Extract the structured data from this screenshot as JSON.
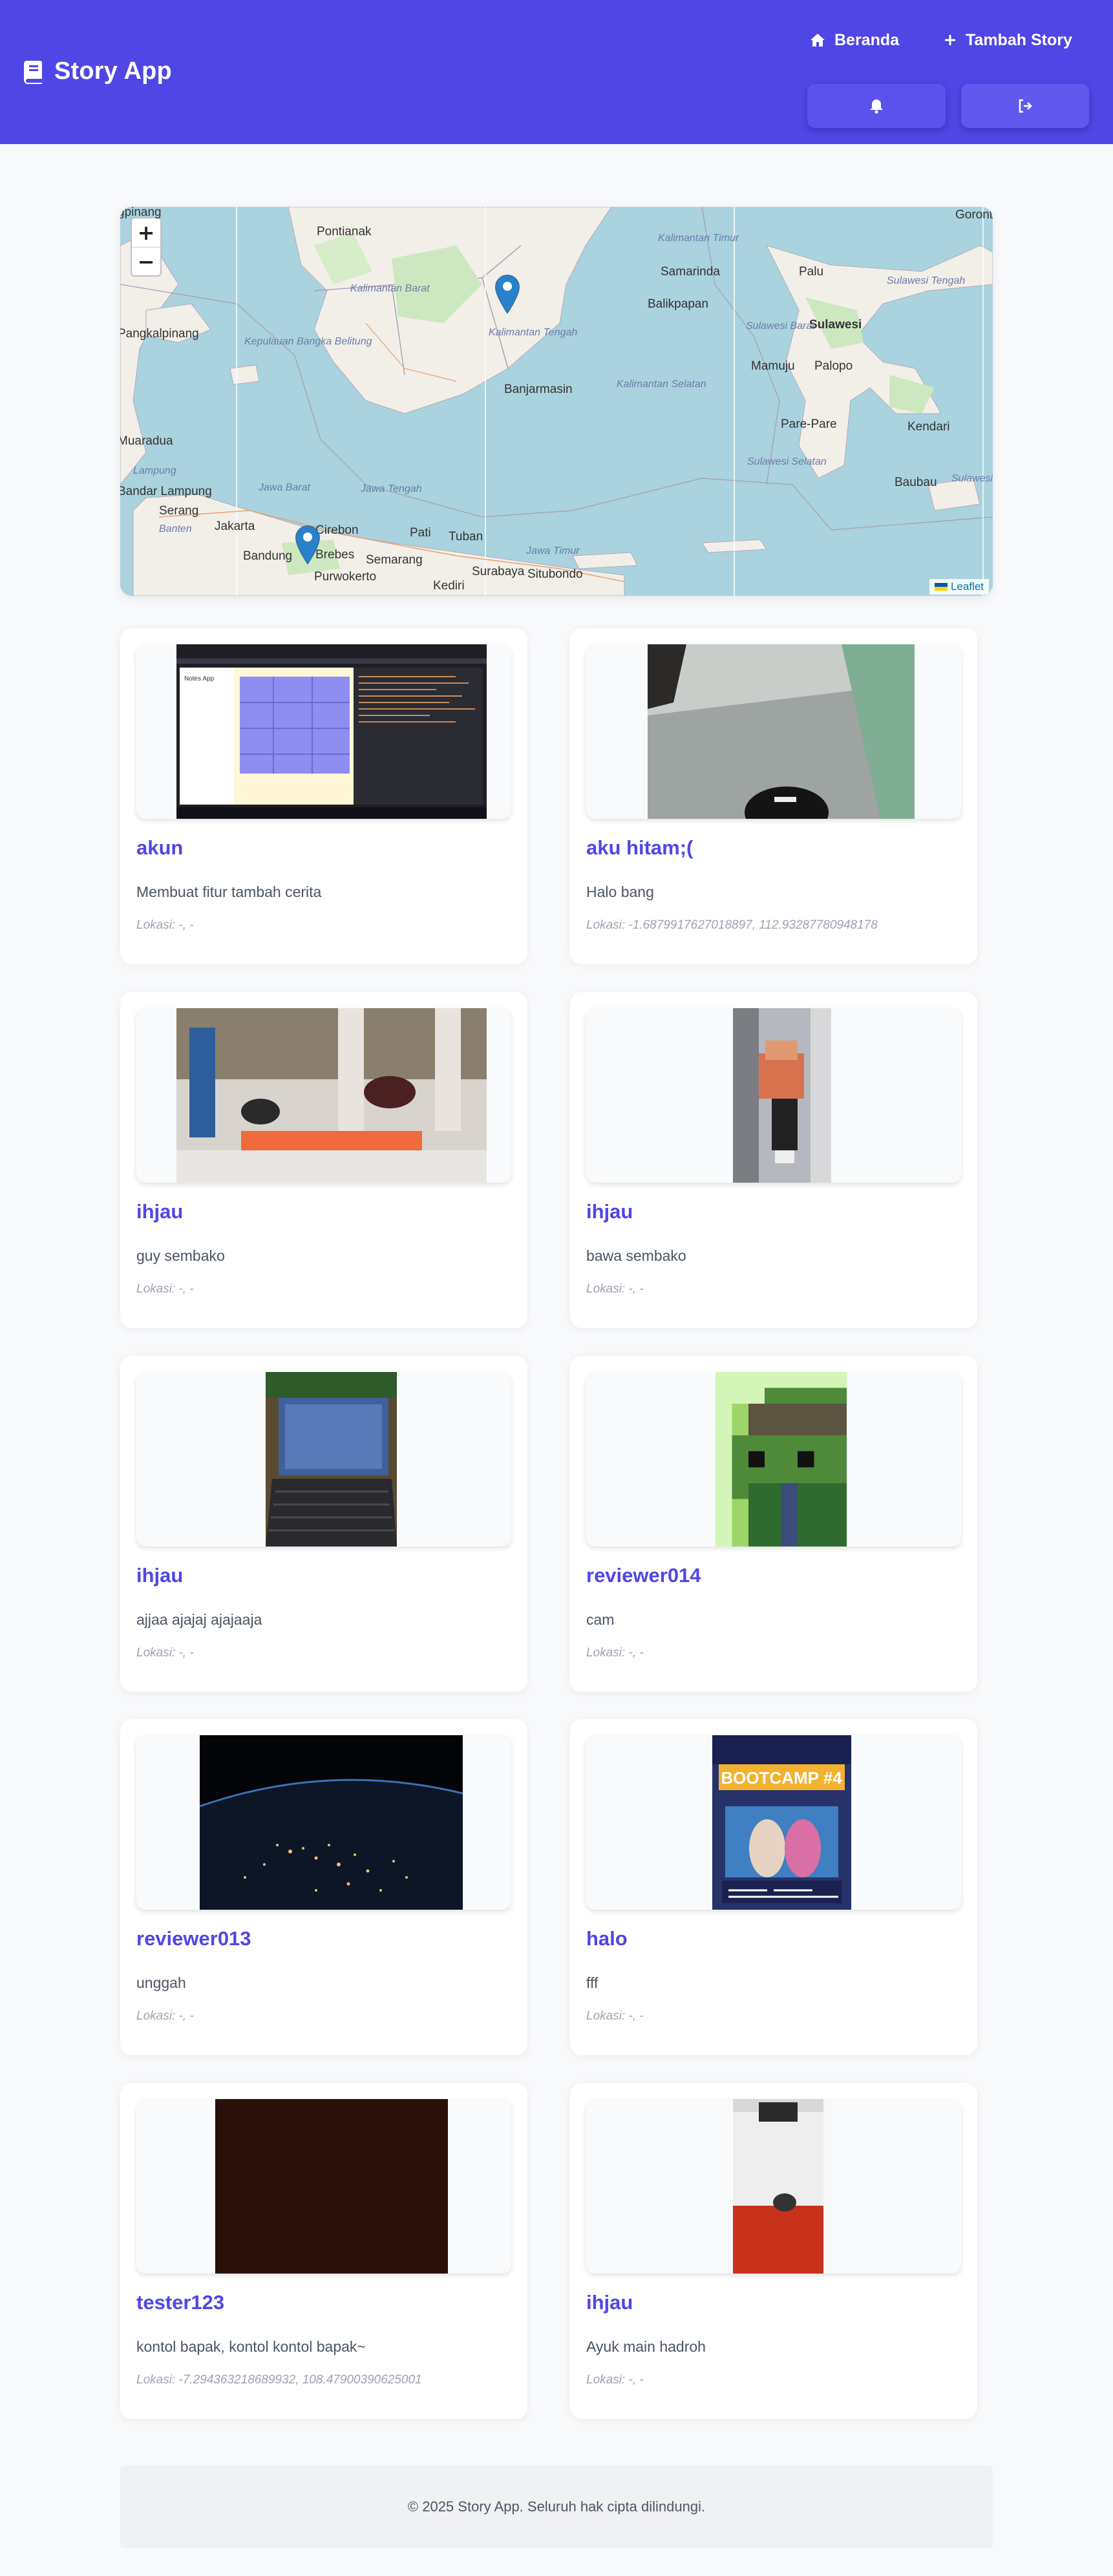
{
  "header": {
    "app_title": "Story App",
    "nav": {
      "home": "Beranda",
      "add": "Tambah Story"
    },
    "icons": {
      "brand": "book-icon",
      "home": "home-icon",
      "add": "plus-icon",
      "notify": "bell-icon",
      "logout": "logout-icon"
    },
    "colors": {
      "primary": "#4f46e5"
    }
  },
  "map": {
    "zoom_in": "+",
    "zoom_out": "−",
    "attribution": "Leaflet",
    "labels": {
      "pangkalpinang": "Pangkalpinang",
      "pontianak": "Pontianak",
      "samarinda": "Samarinda",
      "balikpapan": "Balikpapan",
      "palu": "Palu",
      "sulawesi": "Sulawesi",
      "mamuju": "Mamuju",
      "palopo": "Palopo",
      "banjarmasin": "Banjarmasin",
      "pare_pare": "Pare-Pare",
      "kendari": "Kendari",
      "baubau": "Baubau",
      "bandar_lampung": "Bandar Lampung",
      "serang": "Serang",
      "jakarta": "Jakarta",
      "bandung": "Bandung",
      "cirebon": "Cirebon",
      "brebes": "Brebes",
      "semarang": "Semarang",
      "pati": "Pati",
      "tuban": "Tuban",
      "surabaya": "Surabaya",
      "situbondo": "Situbondo",
      "kediri": "Kediri",
      "purwokerto": "Purwokerto",
      "muaradua": "Muaradua",
      "gorontalo": "Gorontalo",
      "kalimantan_barat": "Kalimantan Barat",
      "kalimantan_tengah": "Kalimantan Tengah",
      "kalimantan_timur": "Kalimantan Timur",
      "kalimantan_selatan": "Kalimantan Selatan",
      "sulawesi_barat": "Sulawesi Barat",
      "sulawesi_selatan": "Sulawesi Selatan",
      "sulawesi_tengah": "Sulawesi Tengah",
      "sulawesi_tenggara": "Sulawesi Tenggara",
      "jawa_barat": "Jawa Barat",
      "jawa_tengah": "Jawa Tengah",
      "jawa_timur": "Jawa Timur",
      "kepulauan_bangka_belitung": "Kepulauan Bangka Belitung",
      "banten": "Banten",
      "lampung": "Lampung",
      "pinang": "gpinang"
    }
  },
  "stories": [
    {
      "name": "akun",
      "description": "Membuat fitur tambah cerita",
      "location": "Lokasi: -, -"
    },
    {
      "name": "aku hitam;(",
      "description": "Halo bang",
      "location": "Lokasi: -1.6879917627018897, 112.93287780948178"
    },
    {
      "name": "ihjau",
      "description": "guy sembako",
      "location": "Lokasi: -, -"
    },
    {
      "name": "ihjau",
      "description": "bawa sembako",
      "location": "Lokasi: -, -"
    },
    {
      "name": "ihjau",
      "description": "ajjaa ajajaj ajajaaja",
      "location": "Lokasi: -, -"
    },
    {
      "name": "reviewer014",
      "description": "cam",
      "location": "Lokasi: -, -"
    },
    {
      "name": "reviewer013",
      "description": "unggah",
      "location": "Lokasi: -, -"
    },
    {
      "name": "halo",
      "description": "fff",
      "location": "Lokasi: -, -"
    },
    {
      "name": "tester123",
      "description": "kontol bapak, kontol kontol bapak~",
      "location": "Lokasi: -7.294363218689932, 108.47900390625001"
    },
    {
      "name": "ihjau",
      "description": "Ayuk main hadroh",
      "location": "Lokasi: -, -"
    }
  ],
  "photo_texts": {
    "poster_title": "BOOTCAMP #4",
    "notes_app": "Notes App"
  },
  "footer": {
    "text": "© 2025 Story App. Seluruh hak cipta dilindungi."
  }
}
